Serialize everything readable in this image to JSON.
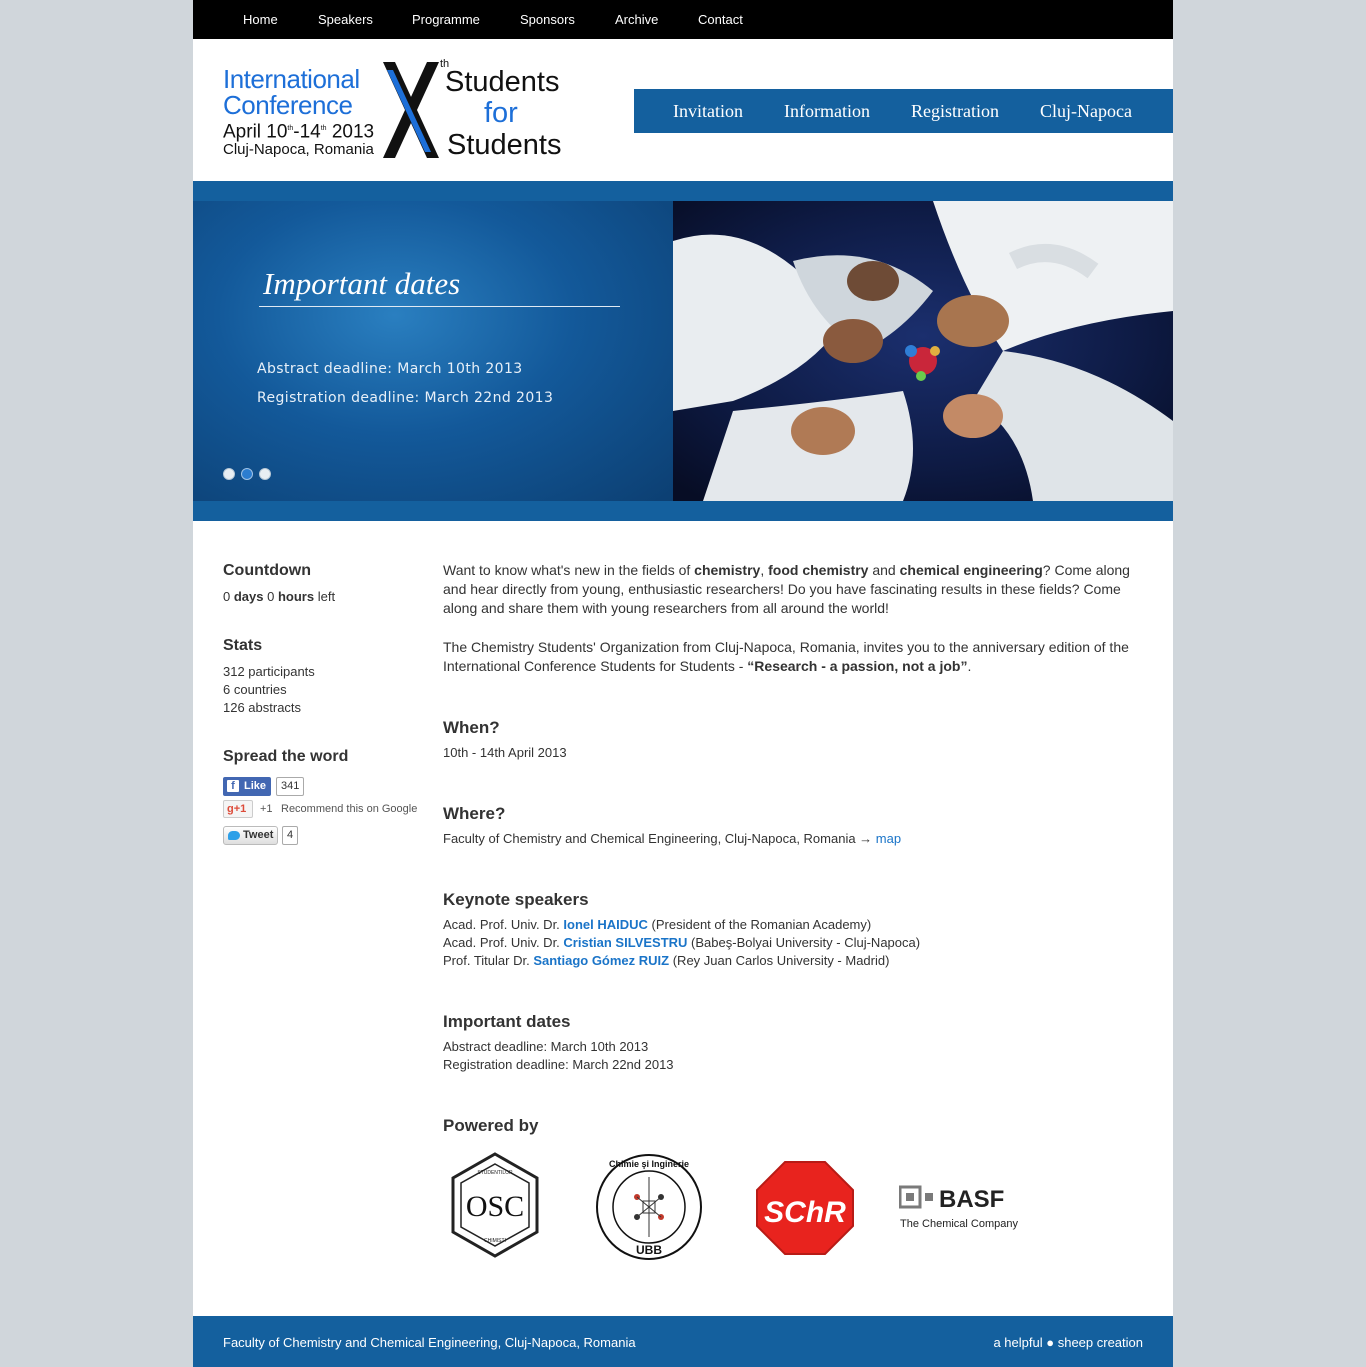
{
  "topnav": [
    "Home",
    "Speakers",
    "Programme",
    "Sponsors",
    "Archive",
    "Contact"
  ],
  "logo": {
    "line1": "International",
    "line2": "Conference",
    "line3_a": "April 10",
    "line3_sup1": "th",
    "line3_b": "-14",
    "line3_sup2": "th",
    "line3_c": " 2013",
    "line4": "Cluj-Napoca, Romania",
    "roman": "X",
    "th": "th",
    "right1": "Students",
    "right2": "for",
    "right3": "Students"
  },
  "mainnav": [
    "Invitation",
    "Information",
    "Registration",
    "Cluj-Napoca"
  ],
  "slider": {
    "title": "Important dates",
    "line1": "Abstract deadline: March 10th 2013",
    "line2": "Registration deadline: March 22nd 2013",
    "active_dot": 2,
    "dot_count": 3
  },
  "sidebar": {
    "countdown_title": "Countdown",
    "days_value": "0",
    "days_label": "days",
    "hours_value": "0",
    "hours_label": "hours",
    "left_label": "left",
    "stats_title": "Stats",
    "stats": [
      "312 participants",
      "6 countries",
      "126 abstracts"
    ],
    "spread_title": "Spread the word",
    "fb_label": "Like",
    "fb_count": "341",
    "g_label": "+1",
    "g_count": "+1",
    "g_text": "Recommend this on Google",
    "tw_label": "Tweet",
    "tw_count": "4"
  },
  "content": {
    "intro_1": "Want to know what's new in the fields of ",
    "intro_b1": "chemistry",
    "intro_2": ", ",
    "intro_b2": "food chemistry",
    "intro_3": " and ",
    "intro_b3": "chemical engineering",
    "intro_4": "? Come along and hear directly from young, enthusiastic researchers! Do you have fascinating results in these fields? Come along and share them with young researchers from all around the world!",
    "invite_1": "The Chemistry Students' Organization from Cluj-Napoca, Romania, invites you to the anniversary edition of the International Conference Students for Students - ",
    "invite_b": "“Research - a passion, not a job”",
    "invite_2": ".",
    "when_title": "When?",
    "when_text": "10th - 14th April 2013",
    "where_title": "Where?",
    "where_text": "Faculty of Chemistry and Chemical Engineering, Cluj-Napoca, Romania → ",
    "where_link": "map",
    "keynote_title": "Keynote speakers",
    "speakers": [
      {
        "prefix": "Acad. Prof. Univ. Dr. ",
        "name": "Ionel HAIDUC",
        "suffix": " (President of the Romanian Academy)"
      },
      {
        "prefix": "Acad. Prof. Univ. Dr. ",
        "name": "Cristian SILVESTRU",
        "suffix": " (Babeş-Bolyai University - Cluj-Napoca)"
      },
      {
        "prefix": "Prof. Titular Dr. ",
        "name": "Santiago Gómez RUIZ",
        "suffix": " (Rey Juan Carlos University - Madrid)"
      }
    ],
    "dates_title": "Important dates",
    "dates": [
      "Abstract deadline: March 10th 2013",
      "Registration deadline: March 22nd 2013"
    ],
    "powered_title": "Powered by"
  },
  "sponsors": {
    "osc_text": "OSC",
    "osc_ring": "FACULTATEA DE CHIMIE ŞI INGINERIE CHIMICĂ · STUDENTILOR · CHIMISTI · ORGANIZATIA",
    "ubb_ring": "Facultatea de Chimie şi Inginerie Chimică",
    "ubb_text": "UBB",
    "schr_text": "SChR",
    "basf_name": "BASF",
    "basf_tag": "The Chemical Company"
  },
  "footer": {
    "left": "Faculty of Chemistry and Chemical Engineering, Cluj-Napoca, Romania",
    "right_a": "a helpful",
    "right_b": "sheep creation"
  },
  "colors": {
    "brand_blue": "#14609e",
    "link_blue": "#1a74c8",
    "logo_blue": "#1d6fd8",
    "background": "#d0d6db",
    "schr_red": "#e8231e"
  }
}
